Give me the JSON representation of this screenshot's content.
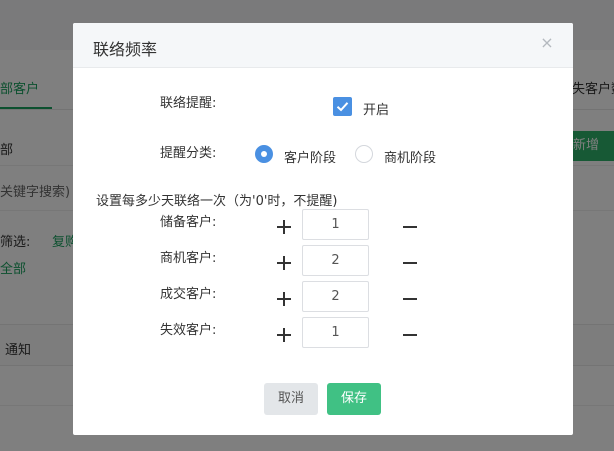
{
  "background": {
    "tab_active": "部客户",
    "tab_right": "失客户数",
    "dept_label": "部",
    "search_hint": "关键字搜索)",
    "new_button": "新增",
    "filter_label": "筛选:",
    "filter_value": "复购",
    "all_label": "全部",
    "notice_text": "通知"
  },
  "dialog": {
    "title": "联络频率",
    "close_icon": "×",
    "reminder_label": "联络提醒:",
    "reminder_option": "开启",
    "reminder_checked": true,
    "category_label": "提醒分类:",
    "category_options": [
      {
        "label": "客户阶段",
        "checked": true
      },
      {
        "label": "商机阶段",
        "checked": false
      }
    ],
    "hint": "设置每多少天联络一次（为'0'时，不提醒)",
    "rows": [
      {
        "label": "储备客户:",
        "value": "1"
      },
      {
        "label": "商机客户:",
        "value": "2"
      },
      {
        "label": "成交客户:",
        "value": "2"
      },
      {
        "label": "失效客户:",
        "value": "1"
      }
    ],
    "cancel_label": "取消",
    "save_label": "保存"
  },
  "colors": {
    "primary_blue": "#4a90e2",
    "save_green": "#40c184",
    "bg_green": "#19a15f"
  }
}
